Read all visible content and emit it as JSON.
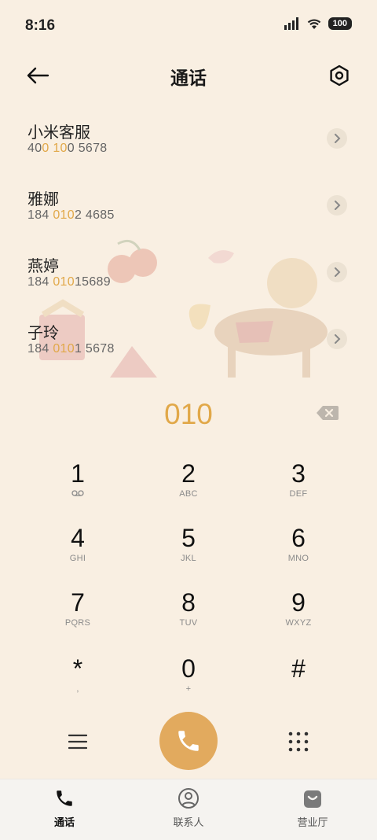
{
  "status": {
    "time": "8:16",
    "battery": "100"
  },
  "header": {
    "title": "通话"
  },
  "contacts": [
    {
      "name": "小米客服",
      "num_parts": [
        "40",
        "0",
        " ",
        "10",
        "0 5678"
      ]
    },
    {
      "name": "雅娜",
      "num_parts": [
        "184 ",
        "010",
        "2 4685",
        "",
        ""
      ]
    },
    {
      "name": "燕婷",
      "num_parts": [
        "184 ",
        "010",
        "15689",
        "",
        ""
      ]
    },
    {
      "name": "子玲",
      "num_parts": [
        "184 ",
        "010",
        "1 5678",
        "",
        ""
      ]
    }
  ],
  "dialer": {
    "digits": "010"
  },
  "keys": [
    {
      "d": "1",
      "l": "voicemail"
    },
    {
      "d": "2",
      "l": "ABC"
    },
    {
      "d": "3",
      "l": "DEF"
    },
    {
      "d": "4",
      "l": "GHI"
    },
    {
      "d": "5",
      "l": "JKL"
    },
    {
      "d": "6",
      "l": "MNO"
    },
    {
      "d": "7",
      "l": "PQRS"
    },
    {
      "d": "8",
      "l": "TUV"
    },
    {
      "d": "9",
      "l": "WXYZ"
    },
    {
      "d": "*",
      "l": ","
    },
    {
      "d": "0",
      "l": "+"
    },
    {
      "d": "#",
      "l": ""
    }
  ],
  "tabs": [
    {
      "label": "通话",
      "icon": "phone-icon"
    },
    {
      "label": "联系人",
      "icon": "contact-icon"
    },
    {
      "label": "营业厅",
      "icon": "shopping-bag-icon"
    }
  ],
  "colors": {
    "accent": "#e1a849",
    "background": "#f9efe2",
    "call": "#e2aa5e"
  }
}
